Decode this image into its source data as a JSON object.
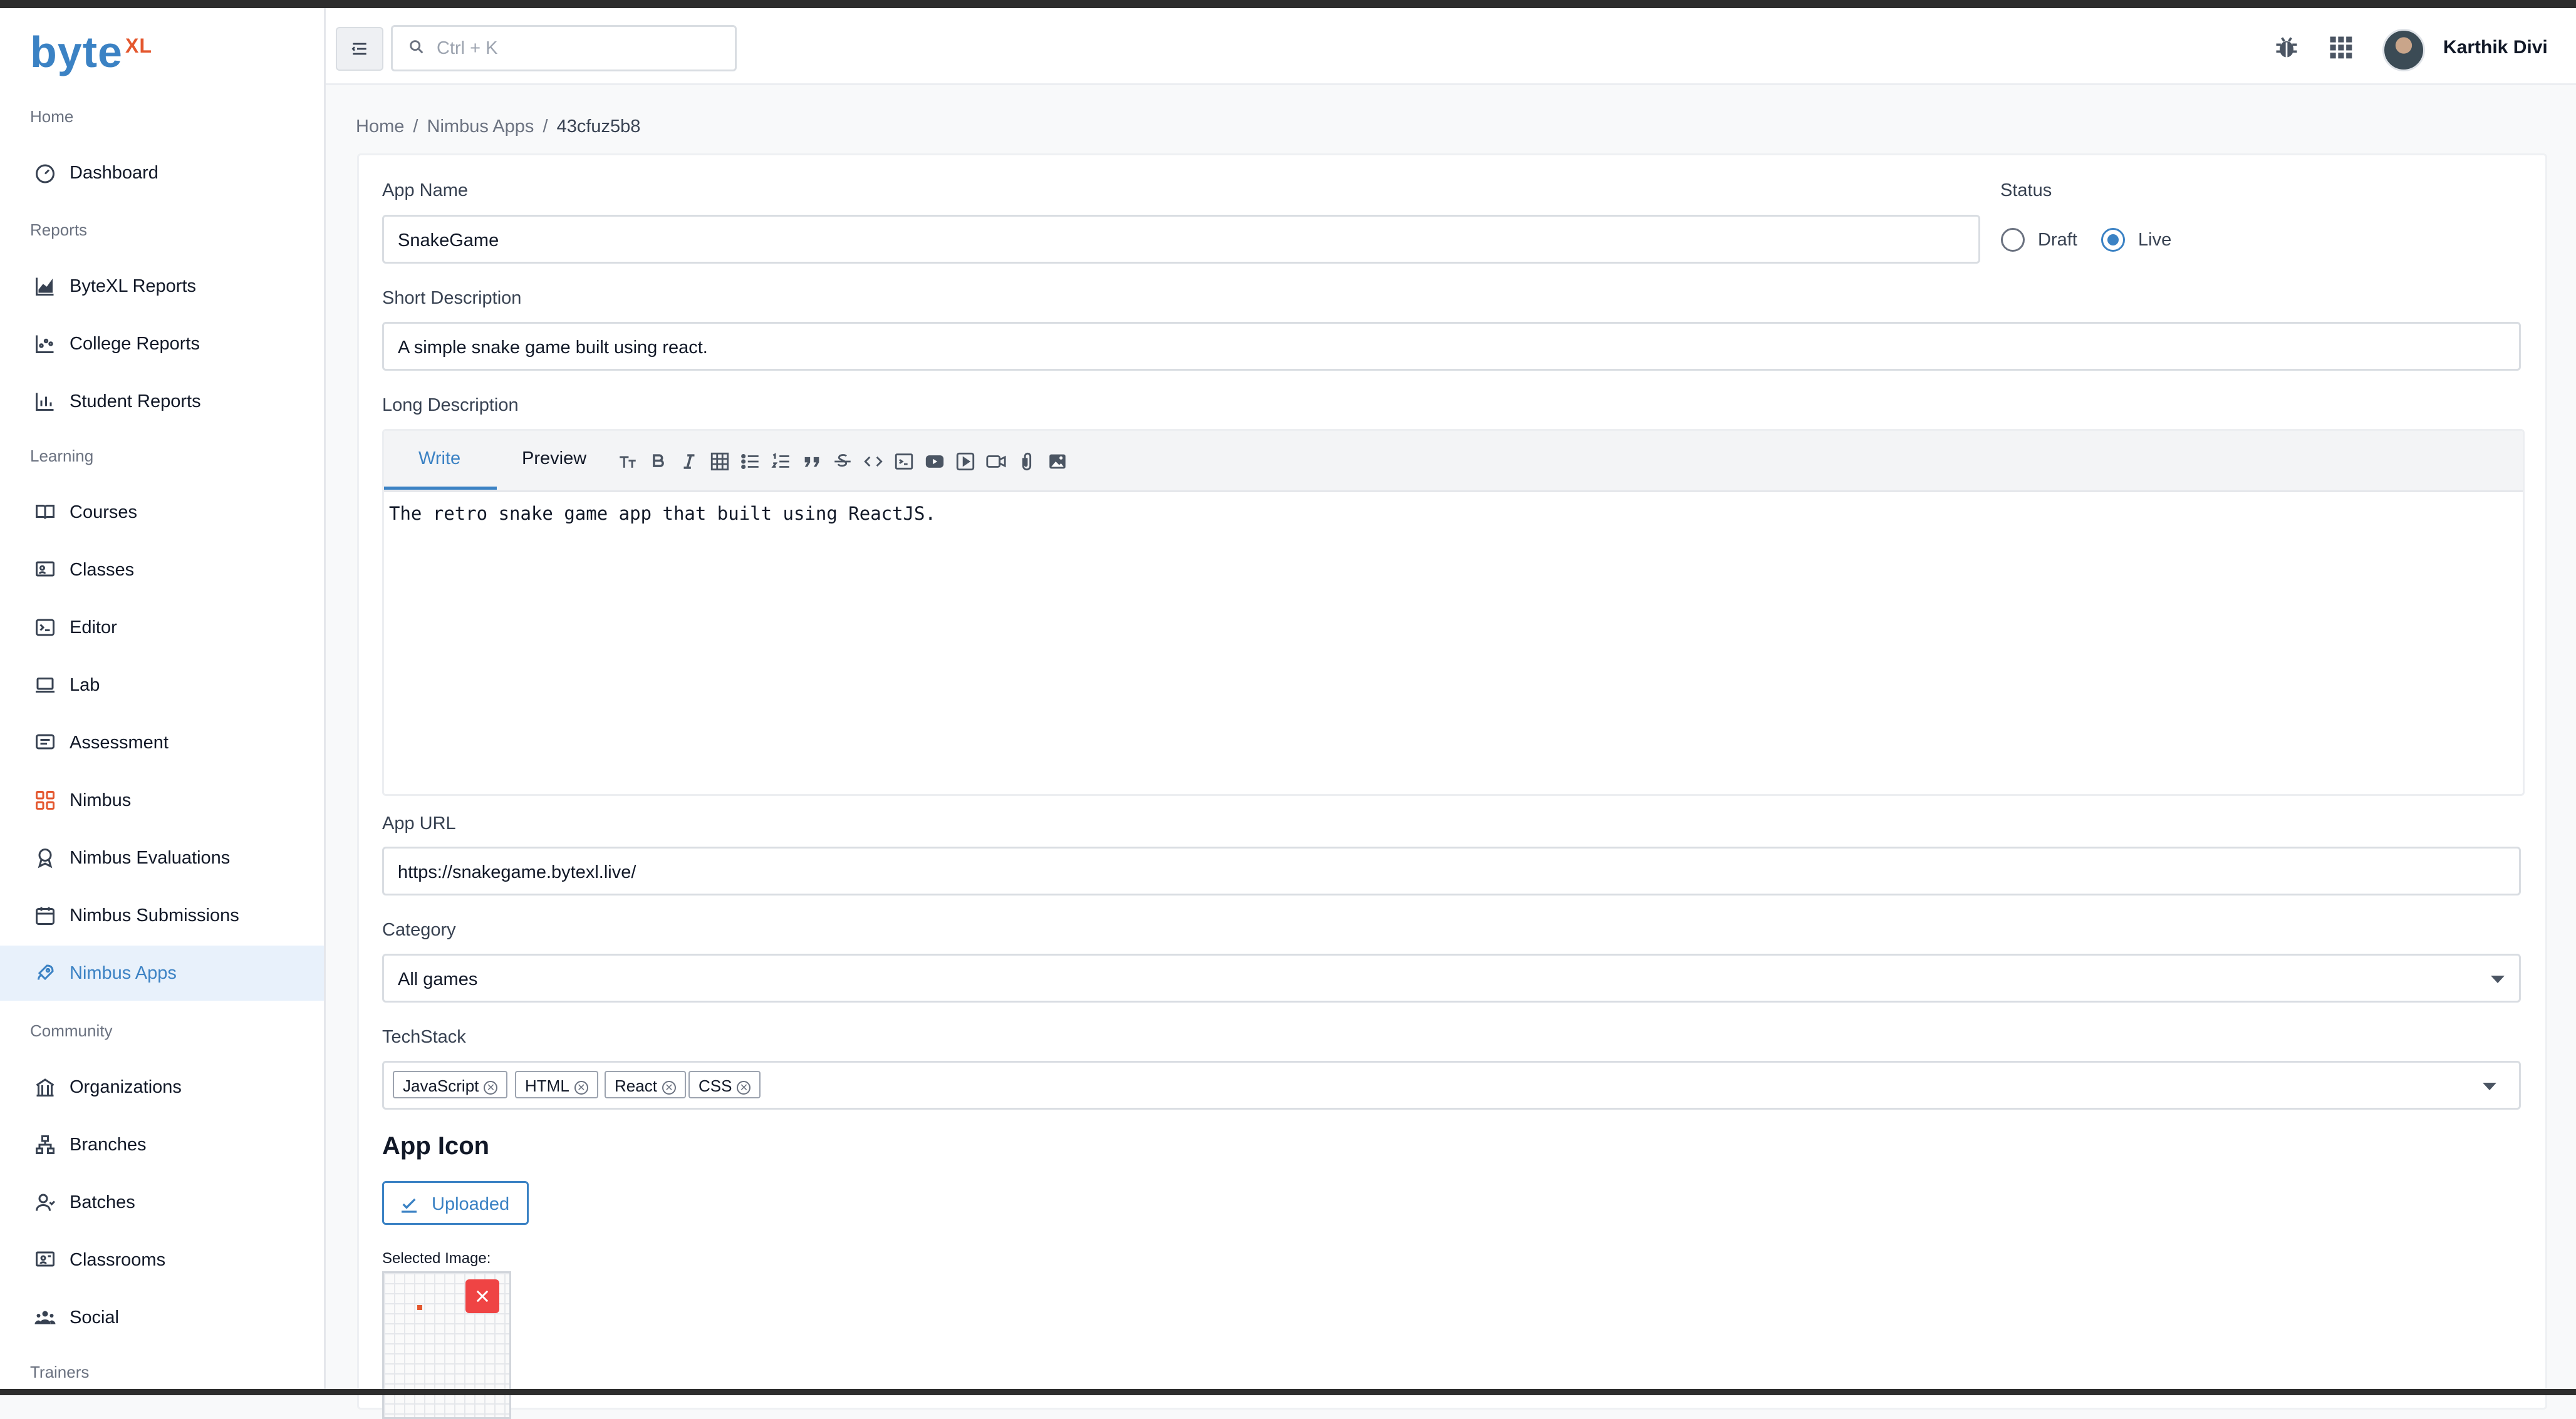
{
  "brand": {
    "name": "byte",
    "sup": "XL"
  },
  "header": {
    "search_placeholder": "Ctrl + K",
    "user_name": "Karthik Divi"
  },
  "sidebar": {
    "sections": [
      "Home",
      "Reports",
      "Learning",
      "Community",
      "Trainers"
    ],
    "items": [
      {
        "label": "Dashboard"
      },
      {
        "label": "ByteXL Reports"
      },
      {
        "label": "College Reports"
      },
      {
        "label": "Student Reports"
      },
      {
        "label": "Courses"
      },
      {
        "label": "Classes"
      },
      {
        "label": "Editor"
      },
      {
        "label": "Lab"
      },
      {
        "label": "Assessment"
      },
      {
        "label": "Nimbus"
      },
      {
        "label": "Nimbus Evaluations"
      },
      {
        "label": "Nimbus Submissions"
      },
      {
        "label": "Nimbus Apps"
      },
      {
        "label": "Organizations"
      },
      {
        "label": "Branches"
      },
      {
        "label": "Batches"
      },
      {
        "label": "Classrooms"
      },
      {
        "label": "Social"
      }
    ]
  },
  "breadcrumb": [
    "Home",
    "/",
    "Nimbus Apps",
    "/",
    "43cfuz5b8"
  ],
  "form": {
    "app_name_label": "App Name",
    "app_name_value": "SnakeGame",
    "status_label": "Status",
    "status_options": [
      "Draft",
      "Live"
    ],
    "status_selected": "Live",
    "short_desc_label": "Short Description",
    "short_desc_value": "A simple snake game built using react.",
    "long_desc_label": "Long Description",
    "editor_tabs": [
      "Write",
      "Preview"
    ],
    "long_desc_value": "The retro snake game app that built using ReactJS.",
    "app_url_label": "App URL",
    "app_url_value": "https://snakegame.bytexl.live/",
    "category_label": "Category",
    "category_value": "All games",
    "techstack_label": "TechStack",
    "techstack": [
      "JavaScript",
      "HTML",
      "React",
      "CSS"
    ],
    "app_icon_title": "App Icon",
    "upload_button": "Uploaded",
    "selected_image_label": "Selected Image:"
  },
  "colors": {
    "accent": "#3b82c4",
    "brand_sup": "#e4572e",
    "danger": "#ef4444"
  }
}
